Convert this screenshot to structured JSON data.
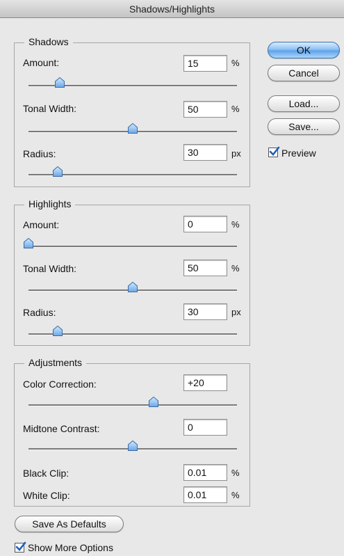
{
  "window": {
    "title": "Shadows/Highlights"
  },
  "buttons": {
    "ok": "OK",
    "cancel": "Cancel",
    "load": "Load...",
    "save": "Save...",
    "save_defaults": "Save As Defaults"
  },
  "preview": {
    "label": "Preview",
    "checked": true
  },
  "show_more": {
    "label": "Show More Options",
    "checked": true
  },
  "shadows": {
    "title": "Shadows",
    "amount": {
      "label": "Amount:",
      "value": "15",
      "unit": "%",
      "slider": 0.15
    },
    "tonal_width": {
      "label": "Tonal Width:",
      "value": "50",
      "unit": "%",
      "slider": 0.5
    },
    "radius": {
      "label": "Radius:",
      "value": "30",
      "unit": "px",
      "slider": 0.14
    }
  },
  "highlights": {
    "title": "Highlights",
    "amount": {
      "label": "Amount:",
      "value": "0",
      "unit": "%",
      "slider": 0.0
    },
    "tonal_width": {
      "label": "Tonal Width:",
      "value": "50",
      "unit": "%",
      "slider": 0.5
    },
    "radius": {
      "label": "Radius:",
      "value": "30",
      "unit": "px",
      "slider": 0.14
    }
  },
  "adjustments": {
    "title": "Adjustments",
    "color_correction": {
      "label": "Color Correction:",
      "value": "+20",
      "slider": 0.6
    },
    "midtone_contrast": {
      "label": "Midtone Contrast:",
      "value": "0",
      "slider": 0.5
    },
    "black_clip": {
      "label": "Black Clip:",
      "value": "0.01",
      "unit": "%"
    },
    "white_clip": {
      "label": "White Clip:",
      "value": "0.01",
      "unit": "%"
    }
  },
  "colors": {
    "accent": "#5fa3ea",
    "thumb": "#6aa7e6"
  }
}
